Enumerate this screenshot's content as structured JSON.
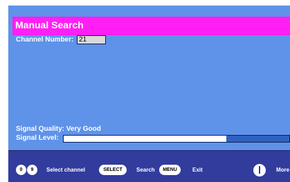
{
  "title": "Manual Search",
  "channel": {
    "label": "Channel Number:",
    "value": "21"
  },
  "signal": {
    "quality_text": "Signal Quality: Very Good",
    "level_label": "Signal Level:",
    "level_fraction": 0.72
  },
  "footer": {
    "key_0": "0",
    "key_9": "9",
    "select_channel": "Select channel",
    "select_key": "SELECT",
    "search": "Search",
    "menu_key": "MENU",
    "exit": "Exit",
    "more": "More"
  },
  "colors": {
    "background": "#5f92e9",
    "title_bar": "#ff1ff5",
    "footer": "#323c9d"
  }
}
